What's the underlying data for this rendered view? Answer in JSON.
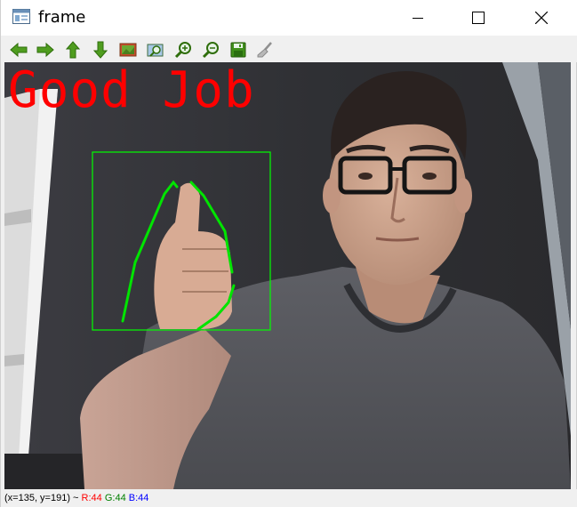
{
  "window": {
    "title": "frame"
  },
  "toolbar": {
    "buttons": [
      {
        "icon": "arrow-left-icon",
        "tooltip": "Pan left"
      },
      {
        "icon": "arrow-right-icon",
        "tooltip": "Pan right"
      },
      {
        "icon": "arrow-up-icon",
        "tooltip": "Pan up"
      },
      {
        "icon": "arrow-down-icon",
        "tooltip": "Pan down"
      },
      {
        "icon": "zoom-image-icon",
        "tooltip": "Zoom in 100%"
      },
      {
        "icon": "zoom-fit-icon",
        "tooltip": "Zoom to fit"
      },
      {
        "icon": "zoom-in-icon",
        "tooltip": "Zoom in"
      },
      {
        "icon": "zoom-out-icon",
        "tooltip": "Zoom out"
      },
      {
        "icon": "save-icon",
        "tooltip": "Save"
      },
      {
        "icon": "brush-icon",
        "tooltip": "Properties"
      }
    ]
  },
  "frame": {
    "overlay_text": "Good Job",
    "overlay_color": "#ff0000",
    "roi_color": "#00ff00",
    "contour_color": "#00e400"
  },
  "status": {
    "coords": "(x=135, y=191) ~",
    "r": "R:44",
    "g": "G:44",
    "b": "B:44",
    "r_color": "#ff0000",
    "g_color": "#008000",
    "b_color": "#0000ff"
  }
}
